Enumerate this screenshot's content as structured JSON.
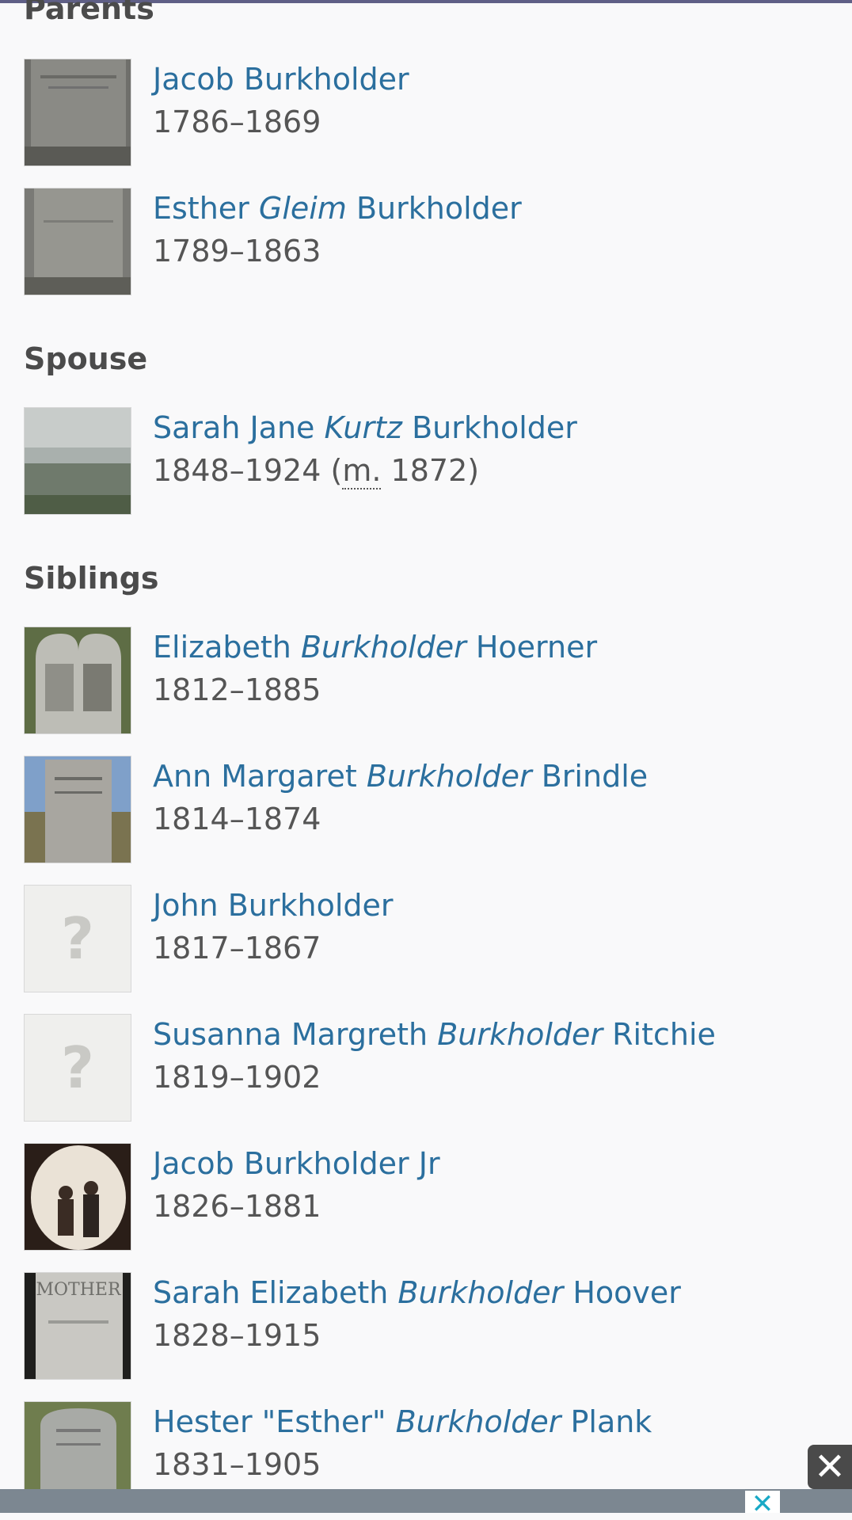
{
  "sections": {
    "parents": "Parents",
    "spouse": "Spouse",
    "siblings": "Siblings"
  },
  "parents": [
    {
      "given": "Jacob",
      "maiden": "",
      "surname": "Burkholder",
      "dates": "1786–1869"
    },
    {
      "given": "Esther",
      "maiden": "Gleim",
      "surname": "Burkholder",
      "dates": "1789–1863"
    }
  ],
  "spouse": [
    {
      "given": "Sarah Jane",
      "maiden": "Kurtz",
      "surname": "Burkholder",
      "dates": "1848–1924",
      "married_prefix": "(",
      "married_abbr": "m.",
      "married_year": "1872)"
    }
  ],
  "siblings": [
    {
      "given": "Elizabeth",
      "maiden": "Burkholder",
      "surname": "Hoerner",
      "dates": "1812–1885"
    },
    {
      "given": "Ann Margaret",
      "maiden": "Burkholder",
      "surname": "Brindle",
      "dates": "1814–1874"
    },
    {
      "given": "John",
      "maiden": "",
      "surname": "Burkholder",
      "dates": "1817–1867",
      "placeholder_glyph": "?"
    },
    {
      "given": "Susanna Margreth",
      "maiden": "Burkholder",
      "surname": "Ritchie",
      "dates": "1819–1902",
      "placeholder_glyph": "?"
    },
    {
      "given": "Jacob",
      "maiden": "",
      "surname": "Burkholder Jr",
      "dates": "1826–1881"
    },
    {
      "given": "Sarah Elizabeth",
      "maiden": "Burkholder",
      "surname": "Hoover",
      "dates": "1828–1915",
      "thumb_text": "MOTHER"
    },
    {
      "given": "Hester \"Esther\"",
      "maiden": "Burkholder",
      "surname": "Plank",
      "dates": "1831–1905"
    }
  ],
  "ad": {
    "close_glyph": "✕",
    "close_glyph_small": "✕"
  },
  "colors": {
    "link": "#2b6f9e",
    "heading": "#4b4b4b",
    "dates": "#555555",
    "background": "#f9f9fa"
  }
}
